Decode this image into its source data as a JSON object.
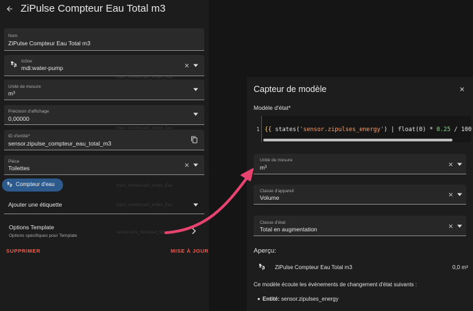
{
  "left_dialog": {
    "title": "ZiPulse Compteur Eau Total m3",
    "fields": {
      "name": {
        "label": "Nom",
        "value": "ZiPulse Compteur Eau Total m3"
      },
      "icon": {
        "label": "Icône",
        "value": "mdi:water-pump"
      },
      "unit": {
        "label": "Unité de mesure",
        "value": "m³"
      },
      "precision": {
        "label": "Précision d'affichage",
        "value": "0,00000"
      },
      "entity_id": {
        "label": "ID d'entité*",
        "value": "sensor.zipulse_compteur_eau_total_m3"
      },
      "area": {
        "label": "Pièce",
        "value": "Toilettes"
      }
    },
    "chip": {
      "label": "Compteur d'eau"
    },
    "add_label": "Ajouter une étiquette",
    "template_options": {
      "title": "Options Template",
      "subtitle": "Options spécifiques pour Template"
    },
    "delete_button": "SUPPRIMER",
    "update_button": "MISE À JOUR"
  },
  "right_dialog": {
    "title": "Capteur de modèle",
    "state_template_label": "Modèle d'état*",
    "code": {
      "line_number": "1",
      "brace_open": "{{",
      "fn": " states(",
      "str": "'sensor.zipulses_energy'",
      "mid": ") | float(0) * ",
      "num": "0.25",
      "tail": " / 100"
    },
    "unit": {
      "label": "Unité de mesure",
      "value": "m³"
    },
    "device_class": {
      "label": "Classe d'appareil",
      "value": "Volume"
    },
    "state_class": {
      "label": "Classe d'état",
      "value": "Total en augmentation"
    },
    "preview_label": "Aperçu:",
    "preview": {
      "name": "ZiPulse Compteur Eau Total m3",
      "value": "0,0 m³"
    },
    "listen_text": "Ce modèle écoute les événements de changement d'état suivants :",
    "entity_prefix": "Entité:",
    "entity_value": "sensor.zipulses_energy"
  },
  "colors": {
    "accent_red": "#f35b4f",
    "arrow_pink": "#e8436f",
    "chip_blue": "#2d5a8c"
  }
}
